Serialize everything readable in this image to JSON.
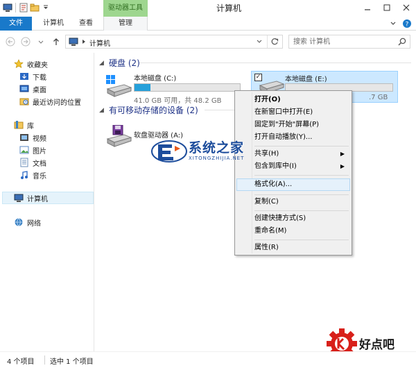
{
  "window": {
    "title": "计算机",
    "contextual_group": "驱动器工具"
  },
  "ribbon": {
    "tabs": [
      {
        "label": "文件",
        "active": true
      },
      {
        "label": "计算机"
      },
      {
        "label": "查看"
      },
      {
        "label": "管理"
      }
    ]
  },
  "address": {
    "path": "计算机",
    "search_placeholder": "搜索 计算机"
  },
  "nav": {
    "items": [
      {
        "label": "收藏夹",
        "icon": "star-icon"
      },
      {
        "label": "下载",
        "icon": "downloads-folder-icon"
      },
      {
        "label": "桌面",
        "icon": "desktop-folder-icon"
      },
      {
        "label": "最近访问的位置",
        "icon": "recent-places-icon"
      },
      {
        "label": "库",
        "icon": "libraries-icon"
      },
      {
        "label": "视频",
        "icon": "videos-icon"
      },
      {
        "label": "图片",
        "icon": "pictures-icon"
      },
      {
        "label": "文档",
        "icon": "documents-icon"
      },
      {
        "label": "音乐",
        "icon": "music-icon"
      },
      {
        "label": "计算机",
        "icon": "computer-icon",
        "selected": true
      },
      {
        "label": "网络",
        "icon": "network-icon"
      }
    ]
  },
  "content": {
    "groups": [
      {
        "title": "硬盘 (2)"
      },
      {
        "title": "有可移动存储的设备 (2)"
      }
    ],
    "drives": [
      {
        "name": "本地磁盘 (C:)",
        "info": "41.0 GB 可用，共 48.2 GB",
        "used_fraction": 0.15,
        "icon": "windows-drive-icon"
      },
      {
        "name": "本地磁盘 (E:)",
        "info": ".7 GB",
        "used_fraction": 0.0,
        "icon": "hard-drive-icon",
        "selected": true
      },
      {
        "name": "软盘驱动器 (A:)",
        "icon": "floppy-drive-icon"
      }
    ]
  },
  "context_menu": {
    "items": [
      {
        "label": "打开(O)",
        "bold": true
      },
      {
        "label": "在新窗口中打开(E)"
      },
      {
        "label": "固定到\"开始\"屏幕(P)"
      },
      {
        "label": "打开自动播放(Y)..."
      },
      {
        "label": "共享(H)",
        "submenu": true
      },
      {
        "label": "包含到库中(I)",
        "submenu": true
      },
      {
        "label": "格式化(A)...",
        "highlighted": true
      },
      {
        "label": "复制(C)"
      },
      {
        "label": "创建快捷方式(S)"
      },
      {
        "label": "重命名(M)"
      },
      {
        "label": "属性(R)"
      }
    ]
  },
  "status": {
    "item_count": "4 个项目",
    "selected_count": "选中 1 个项目"
  },
  "watermarks": {
    "site1": "系统之家",
    "site1_sub": "XITONGZHIJIA.NET",
    "site2": "好点吧"
  },
  "colors": {
    "file_tab": "#1979ca",
    "contextual_tab": "#9ed68f",
    "drive_bar_fill": "#26a0da",
    "selection": "#cce8ff",
    "group_header": "#1e3287"
  }
}
